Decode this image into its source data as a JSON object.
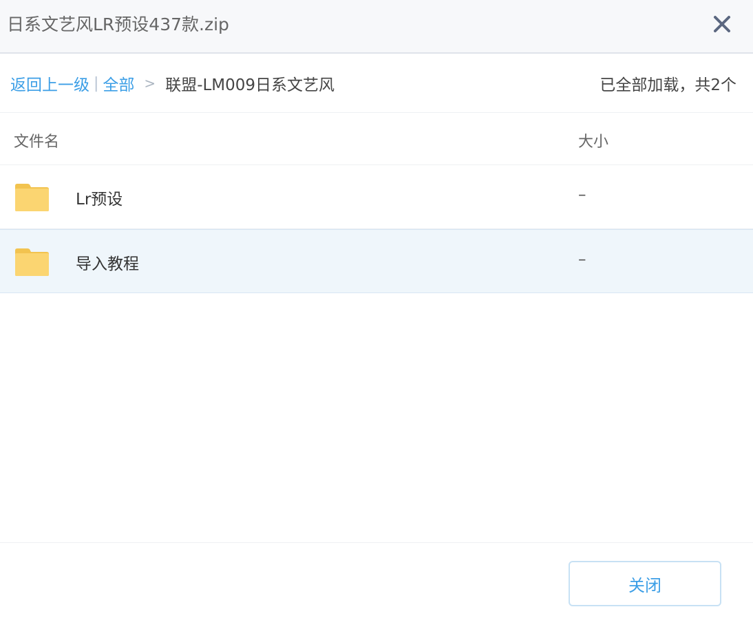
{
  "dialog": {
    "title": "日系文艺风LR预设437款.zip"
  },
  "breadcrumb": {
    "back_label": "返回上一级",
    "divider": "|",
    "all_label": "全部",
    "separator": ">",
    "current": "联盟-LM009日系文艺风",
    "status": "已全部加载，共2个"
  },
  "table": {
    "headers": {
      "name": "文件名",
      "size": "大小"
    },
    "rows": [
      {
        "name": "Lr预设",
        "size": "–",
        "icon": "folder-icon",
        "selected": false
      },
      {
        "name": "导入教程",
        "size": "–",
        "icon": "folder-icon",
        "selected": true
      }
    ]
  },
  "footer": {
    "close_label": "关闭"
  },
  "colors": {
    "link": "#3b9ee6",
    "folder": "#fbd571",
    "selected_row": "#eff6fb"
  }
}
